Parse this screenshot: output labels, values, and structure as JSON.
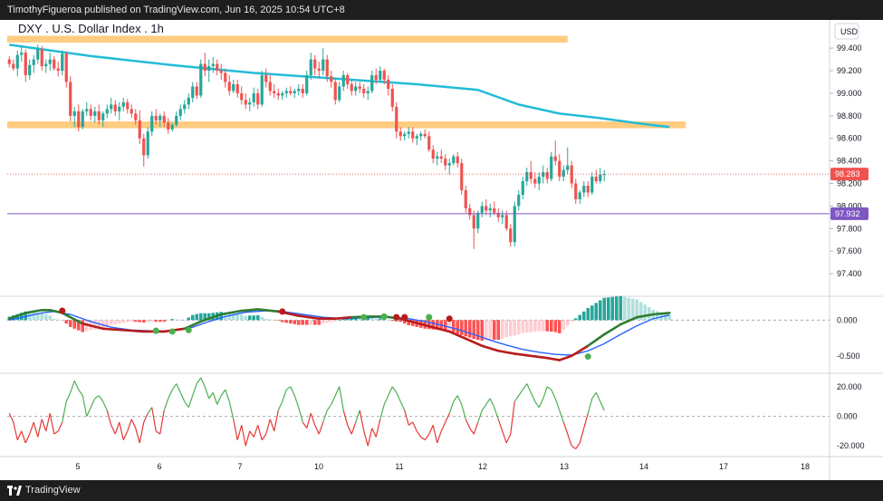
{
  "header": {
    "published": "TimothyFigueroa published on TradingView.com, Jun 16, 2025 10:54 UTC+8"
  },
  "footer": {
    "brand": "TradingView"
  },
  "chart_data": {
    "type": "candlestick",
    "title": "DXY . U.S. Dollar Index . 1h",
    "currency": "USD",
    "colors": {
      "up": "#26a69a",
      "down": "#ef5350",
      "ma": "#22bcd6",
      "zone": "#ffcc80",
      "last_price": "#ef5350",
      "level": "#7e57c2",
      "macd_main": "#2e7d32",
      "macd_signal": "#b71c1c",
      "osc_up": "#4caf50",
      "osc_down": "#e53935"
    },
    "price_ticks": [
      "99.400",
      "99.200",
      "99.000",
      "98.800",
      "98.600",
      "98.400",
      "98.200",
      "98.000",
      "97.800",
      "97.600",
      "97.400"
    ],
    "ylim": [
      97.24,
      99.57
    ],
    "x_tick_labels": [
      "5",
      "6",
      "7",
      "10",
      "11",
      "12",
      "13",
      "14",
      "17",
      "18"
    ],
    "last_price": {
      "label": "98.283",
      "value": 98.283
    },
    "level_line": {
      "label": "97.932",
      "value": 97.932
    },
    "resistance_zones": [
      {
        "low": 99.45,
        "high": 99.51,
        "x_end_bar": 137
      },
      {
        "low": 98.69,
        "high": 98.75,
        "x_end_bar": 166
      }
    ],
    "ma": [
      [
        0,
        99.43
      ],
      [
        20,
        99.33
      ],
      [
        40,
        99.25
      ],
      [
        60,
        99.18
      ],
      [
        80,
        99.13
      ],
      [
        100,
        99.08
      ],
      [
        115,
        99.03
      ],
      [
        125,
        98.9
      ],
      [
        135,
        98.82
      ],
      [
        145,
        98.78
      ],
      [
        155,
        98.73
      ],
      [
        162,
        98.7
      ]
    ],
    "candles": [
      [
        99.3,
        99.33,
        99.23,
        99.26
      ],
      [
        99.26,
        99.3,
        99.2,
        99.22
      ],
      [
        99.22,
        99.38,
        99.15,
        99.34
      ],
      [
        99.34,
        99.42,
        99.28,
        99.36
      ],
      [
        99.36,
        99.39,
        99.1,
        99.16
      ],
      [
        99.16,
        99.3,
        99.12,
        99.25
      ],
      [
        99.25,
        99.34,
        99.18,
        99.3
      ],
      [
        99.3,
        99.43,
        99.26,
        99.39
      ],
      [
        99.39,
        99.42,
        99.2,
        99.24
      ],
      [
        99.24,
        99.3,
        99.18,
        99.26
      ],
      [
        99.26,
        99.36,
        99.2,
        99.3
      ],
      [
        99.3,
        99.33,
        99.2,
        99.22
      ],
      [
        99.22,
        99.28,
        99.15,
        99.2
      ],
      [
        99.2,
        99.38,
        99.16,
        99.35
      ],
      [
        99.35,
        99.37,
        99.05,
        99.1
      ],
      [
        99.1,
        99.15,
        98.75,
        98.8
      ],
      [
        98.8,
        98.88,
        98.7,
        98.84
      ],
      [
        98.84,
        98.9,
        98.66,
        98.7
      ],
      [
        98.7,
        98.86,
        98.68,
        98.84
      ],
      [
        98.84,
        98.92,
        98.8,
        98.86
      ],
      [
        98.86,
        98.9,
        98.76,
        98.8
      ],
      [
        98.8,
        98.88,
        98.74,
        98.84
      ],
      [
        98.84,
        98.9,
        98.72,
        98.76
      ],
      [
        98.76,
        98.84,
        98.7,
        98.82
      ],
      [
        98.82,
        98.9,
        98.78,
        98.86
      ],
      [
        98.86,
        98.96,
        98.82,
        98.9
      ],
      [
        98.9,
        98.94,
        98.8,
        98.84
      ],
      [
        98.84,
        98.92,
        98.76,
        98.88
      ],
      [
        98.88,
        98.96,
        98.84,
        98.92
      ],
      [
        98.92,
        98.95,
        98.82,
        98.86
      ],
      [
        98.86,
        98.9,
        98.78,
        98.82
      ],
      [
        98.82,
        98.86,
        98.72,
        98.76
      ],
      [
        98.76,
        98.85,
        98.55,
        98.6
      ],
      [
        98.6,
        98.64,
        98.35,
        98.45
      ],
      [
        98.45,
        98.7,
        98.42,
        98.66
      ],
      [
        98.66,
        98.84,
        98.62,
        98.8
      ],
      [
        98.8,
        98.86,
        98.72,
        98.76
      ],
      [
        98.76,
        98.82,
        98.7,
        98.8
      ],
      [
        98.8,
        98.84,
        98.7,
        98.74
      ],
      [
        98.74,
        98.78,
        98.64,
        98.68
      ],
      [
        98.68,
        98.74,
        98.66,
        98.72
      ],
      [
        98.72,
        98.84,
        98.7,
        98.8
      ],
      [
        98.8,
        98.9,
        98.76,
        98.86
      ],
      [
        98.86,
        98.94,
        98.82,
        98.9
      ],
      [
        98.9,
        99.0,
        98.86,
        98.96
      ],
      [
        98.96,
        99.1,
        98.92,
        99.06
      ],
      [
        99.06,
        99.1,
        98.95,
        98.98
      ],
      [
        98.98,
        99.3,
        98.96,
        99.26
      ],
      [
        99.26,
        99.36,
        99.15,
        99.2
      ],
      [
        99.2,
        99.3,
        99.1,
        99.24
      ],
      [
        99.24,
        99.32,
        99.18,
        99.26
      ],
      [
        99.26,
        99.3,
        99.16,
        99.2
      ],
      [
        99.2,
        99.26,
        99.12,
        99.18
      ],
      [
        99.18,
        99.22,
        99.05,
        99.1
      ],
      [
        99.1,
        99.16,
        98.98,
        99.02
      ],
      [
        99.02,
        99.12,
        99.0,
        99.08
      ],
      [
        99.08,
        99.12,
        98.96,
        99.0
      ],
      [
        99.0,
        99.06,
        98.9,
        98.94
      ],
      [
        98.94,
        99.0,
        98.86,
        98.9
      ],
      [
        98.9,
        98.96,
        98.84,
        98.92
      ],
      [
        98.92,
        99.05,
        98.88,
        99.0
      ],
      [
        99.0,
        99.04,
        98.86,
        98.9
      ],
      [
        98.9,
        99.2,
        98.88,
        99.16
      ],
      [
        99.16,
        99.22,
        99.05,
        99.1
      ],
      [
        99.1,
        99.16,
        98.98,
        99.02
      ],
      [
        99.02,
        99.08,
        98.96,
        99.0
      ],
      [
        99.0,
        99.04,
        98.94,
        98.98
      ],
      [
        98.98,
        99.02,
        98.94,
        99.0
      ],
      [
        99.0,
        99.05,
        98.96,
        99.02
      ],
      [
        99.02,
        99.06,
        98.98,
        99.0
      ],
      [
        99.0,
        99.04,
        98.96,
        99.02
      ],
      [
        99.02,
        99.08,
        98.98,
        99.04
      ],
      [
        99.04,
        99.08,
        98.96,
        99.0
      ],
      [
        99.0,
        99.2,
        98.98,
        99.16
      ],
      [
        99.16,
        99.36,
        99.12,
        99.3
      ],
      [
        99.3,
        99.34,
        99.16,
        99.22
      ],
      [
        99.22,
        99.28,
        99.14,
        99.2
      ],
      [
        99.2,
        99.4,
        99.16,
        99.3
      ],
      [
        99.3,
        99.34,
        99.1,
        99.15
      ],
      [
        99.15,
        99.2,
        99.05,
        99.1
      ],
      [
        99.1,
        99.14,
        98.9,
        98.94
      ],
      [
        98.94,
        99.1,
        98.92,
        99.06
      ],
      [
        99.06,
        99.2,
        99.02,
        99.16
      ],
      [
        99.16,
        99.18,
        99.04,
        99.08
      ],
      [
        99.08,
        99.12,
        98.98,
        99.02
      ],
      [
        99.02,
        99.1,
        98.98,
        99.06
      ],
      [
        99.06,
        99.1,
        99.0,
        99.04
      ],
      [
        99.04,
        99.08,
        98.96,
        99.0
      ],
      [
        99.0,
        99.06,
        98.94,
        99.02
      ],
      [
        99.02,
        99.2,
        99.0,
        99.16
      ],
      [
        99.16,
        99.22,
        99.08,
        99.12
      ],
      [
        99.12,
        99.24,
        99.1,
        99.2
      ],
      [
        99.2,
        99.22,
        99.08,
        99.12
      ],
      [
        99.12,
        99.16,
        98.98,
        99.04
      ],
      [
        99.04,
        99.08,
        98.84,
        98.88
      ],
      [
        98.88,
        98.92,
        98.6,
        98.66
      ],
      [
        98.66,
        98.7,
        98.58,
        98.62
      ],
      [
        98.62,
        98.66,
        98.58,
        98.64
      ],
      [
        98.64,
        98.7,
        98.6,
        98.66
      ],
      [
        98.66,
        98.7,
        98.56,
        98.6
      ],
      [
        98.6,
        98.64,
        98.54,
        98.62
      ],
      [
        98.62,
        98.66,
        98.58,
        98.64
      ],
      [
        98.64,
        98.68,
        98.6,
        98.62
      ],
      [
        98.62,
        98.66,
        98.48,
        98.5
      ],
      [
        98.5,
        98.54,
        98.38,
        98.42
      ],
      [
        98.42,
        98.48,
        98.36,
        98.44
      ],
      [
        98.44,
        98.5,
        98.38,
        98.42
      ],
      [
        98.42,
        98.46,
        98.32,
        98.36
      ],
      [
        98.36,
        98.42,
        98.28,
        98.38
      ],
      [
        98.38,
        98.46,
        98.36,
        98.44
      ],
      [
        98.44,
        98.48,
        98.34,
        98.38
      ],
      [
        98.38,
        98.42,
        98.1,
        98.14
      ],
      [
        98.14,
        98.18,
        97.94,
        97.98
      ],
      [
        97.98,
        98.02,
        97.88,
        97.92
      ],
      [
        97.92,
        97.96,
        97.62,
        97.8
      ],
      [
        97.8,
        97.96,
        97.76,
        97.94
      ],
      [
        97.94,
        98.04,
        97.9,
        98.0
      ],
      [
        98.0,
        98.06,
        97.92,
        97.96
      ],
      [
        97.96,
        98.02,
        97.9,
        97.98
      ],
      [
        97.98,
        98.04,
        97.92,
        97.94
      ],
      [
        97.94,
        97.98,
        97.86,
        97.9
      ],
      [
        97.9,
        97.96,
        97.84,
        97.92
      ],
      [
        97.92,
        97.96,
        97.78,
        97.8
      ],
      [
        97.8,
        97.84,
        97.64,
        97.68
      ],
      [
        97.68,
        98.04,
        97.64,
        98.0
      ],
      [
        98.0,
        98.14,
        97.96,
        98.1
      ],
      [
        98.1,
        98.26,
        98.06,
        98.22
      ],
      [
        98.22,
        98.34,
        98.18,
        98.3
      ],
      [
        98.3,
        98.4,
        98.2,
        98.24
      ],
      [
        98.24,
        98.3,
        98.16,
        98.2
      ],
      [
        98.2,
        98.3,
        98.14,
        98.26
      ],
      [
        98.26,
        98.36,
        98.2,
        98.3
      ],
      [
        98.3,
        98.34,
        98.2,
        98.24
      ],
      [
        98.24,
        98.48,
        98.22,
        98.44
      ],
      [
        98.44,
        98.58,
        98.36,
        98.4
      ],
      [
        98.4,
        98.46,
        98.22,
        98.26
      ],
      [
        98.26,
        98.36,
        98.22,
        98.32
      ],
      [
        98.32,
        98.52,
        98.28,
        98.36
      ],
      [
        98.36,
        98.4,
        98.16,
        98.2
      ],
      [
        98.2,
        98.24,
        98.02,
        98.06
      ],
      [
        98.06,
        98.14,
        98.02,
        98.12
      ],
      [
        98.12,
        98.22,
        98.08,
        98.18
      ],
      [
        98.18,
        98.22,
        98.08,
        98.12
      ],
      [
        98.12,
        98.3,
        98.1,
        98.26
      ],
      [
        98.26,
        98.32,
        98.2,
        98.22
      ],
      [
        98.22,
        98.34,
        98.2,
        98.28
      ],
      [
        98.28,
        98.32,
        98.22,
        98.283
      ]
    ],
    "macd": {
      "ticks": [
        "0.000",
        "-0.500"
      ],
      "ylim": [
        -0.68,
        0.27
      ],
      "main": [
        [
          0,
          0.02
        ],
        [
          4,
          0.1
        ],
        [
          8,
          0.14
        ],
        [
          10,
          0.14
        ],
        [
          13,
          0.1
        ],
        [
          18,
          -0.05
        ],
        [
          23,
          -0.12
        ],
        [
          28,
          -0.14
        ],
        [
          33,
          -0.16
        ],
        [
          38,
          -0.16
        ],
        [
          43,
          -0.12
        ],
        [
          47,
          -0.02
        ],
        [
          52,
          0.08
        ],
        [
          57,
          0.13
        ],
        [
          61,
          0.15
        ],
        [
          66,
          0.12
        ],
        [
          71,
          0.06
        ],
        [
          76,
          0.02
        ],
        [
          80,
          0.02
        ],
        [
          84,
          0.04
        ],
        [
          88,
          0.05
        ],
        [
          92,
          0.05
        ],
        [
          96,
          0.02
        ],
        [
          100,
          -0.04
        ],
        [
          104,
          -0.1
        ],
        [
          108,
          -0.16
        ],
        [
          112,
          -0.26
        ],
        [
          116,
          -0.36
        ],
        [
          120,
          -0.43
        ],
        [
          124,
          -0.47
        ],
        [
          128,
          -0.5
        ],
        [
          132,
          -0.53
        ],
        [
          135,
          -0.56
        ],
        [
          138,
          -0.5
        ],
        [
          142,
          -0.36
        ],
        [
          146,
          -0.2
        ],
        [
          150,
          -0.06
        ],
        [
          154,
          0.04
        ],
        [
          158,
          0.08
        ],
        [
          162,
          0.1
        ]
      ],
      "signal": [
        [
          0,
          0.0
        ],
        [
          4,
          0.05
        ],
        [
          8,
          0.1
        ],
        [
          11,
          0.12
        ],
        [
          15,
          0.08
        ],
        [
          20,
          -0.02
        ],
        [
          25,
          -0.1
        ],
        [
          30,
          -0.14
        ],
        [
          35,
          -0.15
        ],
        [
          40,
          -0.15
        ],
        [
          45,
          -0.1
        ],
        [
          49,
          -0.02
        ],
        [
          53,
          0.05
        ],
        [
          58,
          0.11
        ],
        [
          63,
          0.13
        ],
        [
          67,
          0.12
        ],
        [
          72,
          0.08
        ],
        [
          77,
          0.04
        ],
        [
          82,
          0.02
        ],
        [
          86,
          0.03
        ],
        [
          90,
          0.04
        ],
        [
          94,
          0.04
        ],
        [
          98,
          0.02
        ],
        [
          102,
          -0.02
        ],
        [
          106,
          -0.07
        ],
        [
          110,
          -0.13
        ],
        [
          114,
          -0.2
        ],
        [
          118,
          -0.28
        ],
        [
          122,
          -0.35
        ],
        [
          126,
          -0.41
        ],
        [
          130,
          -0.45
        ],
        [
          134,
          -0.48
        ],
        [
          138,
          -0.49
        ],
        [
          142,
          -0.43
        ],
        [
          146,
          -0.33
        ],
        [
          150,
          -0.2
        ],
        [
          154,
          -0.08
        ],
        [
          158,
          0.02
        ],
        [
          162,
          0.07
        ]
      ],
      "dots": [
        [
          13,
          0.13,
          "cross-down"
        ],
        [
          36,
          -0.15,
          "cross-up"
        ],
        [
          40,
          -0.16,
          "cross-up"
        ],
        [
          44,
          -0.14,
          "cross-up"
        ],
        [
          67,
          0.12,
          "cross-down"
        ],
        [
          87,
          0.04,
          "cross-up"
        ],
        [
          92,
          0.05,
          "cross-up"
        ],
        [
          95,
          0.04,
          "cross-down"
        ],
        [
          97,
          0.04,
          "cross-down"
        ],
        [
          103,
          0.04,
          "cross-up"
        ],
        [
          108,
          0.02,
          "cross-down"
        ],
        [
          142,
          -0.51,
          "cross-up"
        ]
      ]
    },
    "oscillator": {
      "ticks": [
        "20.000",
        "0.000",
        "-20.000"
      ],
      "ylim": [
        -26,
        26
      ],
      "values": [
        2,
        -4,
        -16,
        -10,
        -18,
        -12,
        -4,
        -14,
        -2,
        -10,
        2,
        -12,
        -10,
        -4,
        10,
        16,
        24,
        18,
        14,
        0,
        6,
        12,
        14,
        10,
        4,
        -6,
        -12,
        -4,
        -16,
        -10,
        -2,
        -8,
        -18,
        -4,
        2,
        6,
        -10,
        -12,
        4,
        12,
        18,
        22,
        16,
        10,
        6,
        14,
        22,
        26,
        20,
        12,
        16,
        8,
        14,
        18,
        10,
        -2,
        -16,
        -6,
        -20,
        -10,
        -14,
        -6,
        -16,
        -12,
        -2,
        -10,
        4,
        10,
        18,
        20,
        14,
        6,
        -4,
        -8,
        2,
        -6,
        -12,
        -4,
        4,
        8,
        14,
        20,
        4,
        -6,
        -12,
        -4,
        4,
        -10,
        -20,
        -8,
        -14,
        -2,
        8,
        14,
        20,
        16,
        10,
        4,
        -6,
        -4,
        -10,
        -14,
        -16,
        -12,
        -6,
        -18,
        -10,
        -4,
        2,
        10,
        14,
        8,
        -2,
        -8,
        -12,
        -4,
        4,
        8,
        12,
        6,
        -2,
        -10,
        -18,
        -12,
        10,
        14,
        18,
        22,
        16,
        10,
        6,
        12,
        20,
        18,
        12,
        4,
        -4,
        -12,
        -20,
        -22,
        -18,
        -8,
        2,
        12,
        16,
        10,
        4
      ]
    }
  }
}
